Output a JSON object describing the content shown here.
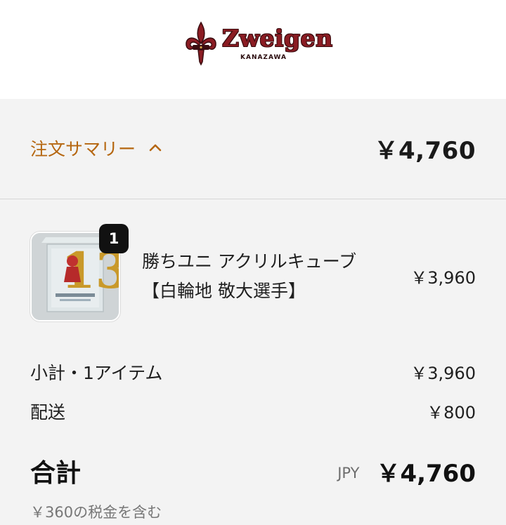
{
  "header": {
    "brand_name": "Zweigen",
    "brand_sub": "KANAZAWA",
    "logo_icon": "fleur-de-lis-icon"
  },
  "summary": {
    "toggle_label": "注文サマリー",
    "toggle_icon": "chevron-up-icon",
    "total": "￥4,760"
  },
  "items": [
    {
      "name_line1": "勝ちユニ アクリルキューブ",
      "name_line2": "【白輪地 敬大選手】",
      "quantity": "1",
      "price": "￥3,960"
    }
  ],
  "totals": {
    "subtotal_label": "小計・1アイテム",
    "subtotal_value": "￥3,960",
    "shipping_label": "配送",
    "shipping_value": "￥800",
    "total_label": "合計",
    "currency": "JPY",
    "total_value": "￥4,760",
    "tax_note": "￥360の税金を含む"
  },
  "colors": {
    "accent": "#b5660f",
    "brand": "#8b1c23",
    "background": "#f3f3f3"
  }
}
